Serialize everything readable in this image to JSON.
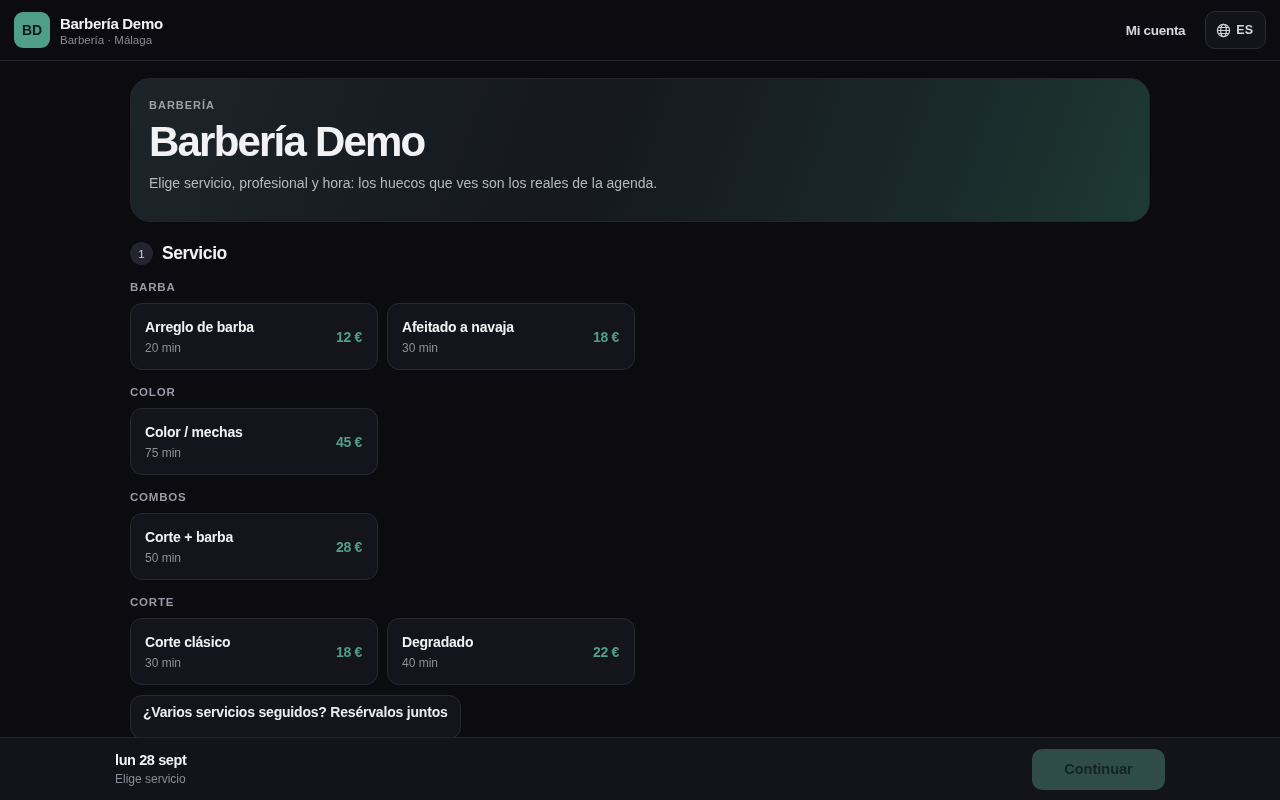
{
  "header": {
    "logo": "BD",
    "title": "Barbería Demo",
    "subtitle": "Barbería · Málaga",
    "account_link": "Mi cuenta",
    "language": "ES"
  },
  "hero": {
    "eyebrow": "BARBERÍA",
    "title": "Barbería Demo",
    "description": "Elige servicio, profesional y hora: los huecos que ves son los reales de la agenda."
  },
  "step": {
    "number": "1",
    "title": "Servicio"
  },
  "categories": [
    {
      "name": "BARBA",
      "services": [
        {
          "name": "Arreglo de barba",
          "duration": "20 min",
          "price": "12 €",
          "selected": false
        },
        {
          "name": "Afeitado a navaja",
          "duration": "30 min",
          "price": "18 €",
          "selected": false
        }
      ]
    },
    {
      "name": "COLOR",
      "services": [
        {
          "name": "Color / mechas",
          "duration": "75 min",
          "price": "45 €",
          "selected": false
        }
      ]
    },
    {
      "name": "COMBOS",
      "services": [
        {
          "name": "Corte + barba",
          "duration": "50 min",
          "price": "28 €",
          "selected": false
        }
      ]
    },
    {
      "name": "CORTE",
      "services": [
        {
          "name": "Corte clásico",
          "duration": "30 min",
          "price": "18 €",
          "selected": false
        },
        {
          "name": "Degradado",
          "duration": "40 min",
          "price": "22 €",
          "selected": false
        }
      ]
    }
  ],
  "multi_service_button": "¿Varios servicios seguidos? Resérvalos juntos",
  "footer": {
    "date": "lun 28 sept",
    "hint": "Elige servicio",
    "continue_button": {
      "label": "Continuar",
      "disabled": true
    }
  }
}
